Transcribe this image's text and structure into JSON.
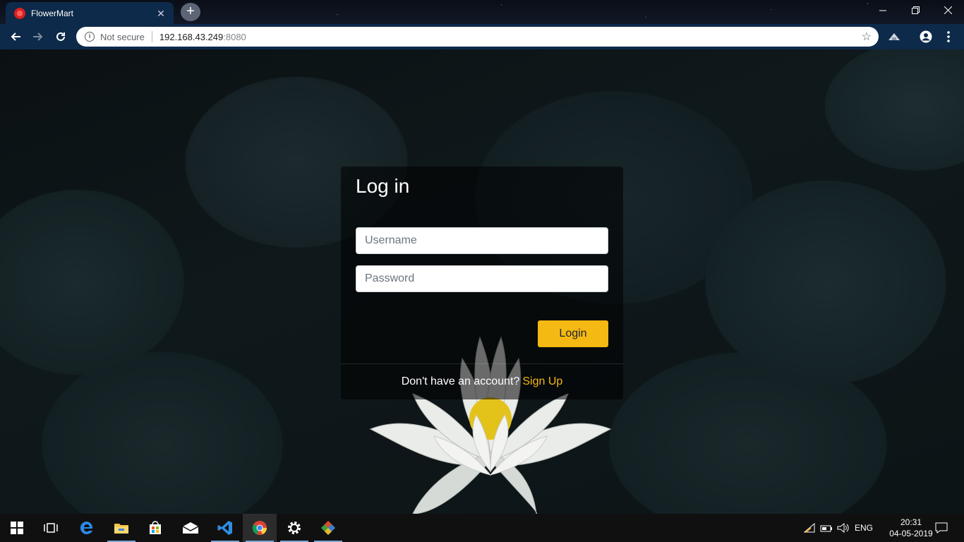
{
  "browser": {
    "tab_title": "FlowerMart",
    "tab_close": "✕",
    "new_tab": "+",
    "security_label": "Not secure",
    "url_host": "192.168.43.249",
    "url_port": ":8080"
  },
  "login": {
    "title": "Log in",
    "username_placeholder": "Username",
    "password_placeholder": "Password",
    "button_label": "Login",
    "footer_text": "Don't have an account?",
    "signup_link": "Sign Up"
  },
  "taskbar": {
    "language": "ENG",
    "time": "20:31",
    "date": "04-05-2019",
    "apps": [
      "windows-start",
      "task-view",
      "edge",
      "file-explorer",
      "store",
      "mail",
      "vscode",
      "chrome",
      "settings",
      "git"
    ]
  },
  "colors": {
    "accent": "#f5b914",
    "toolbar": "#0d2a4a"
  }
}
